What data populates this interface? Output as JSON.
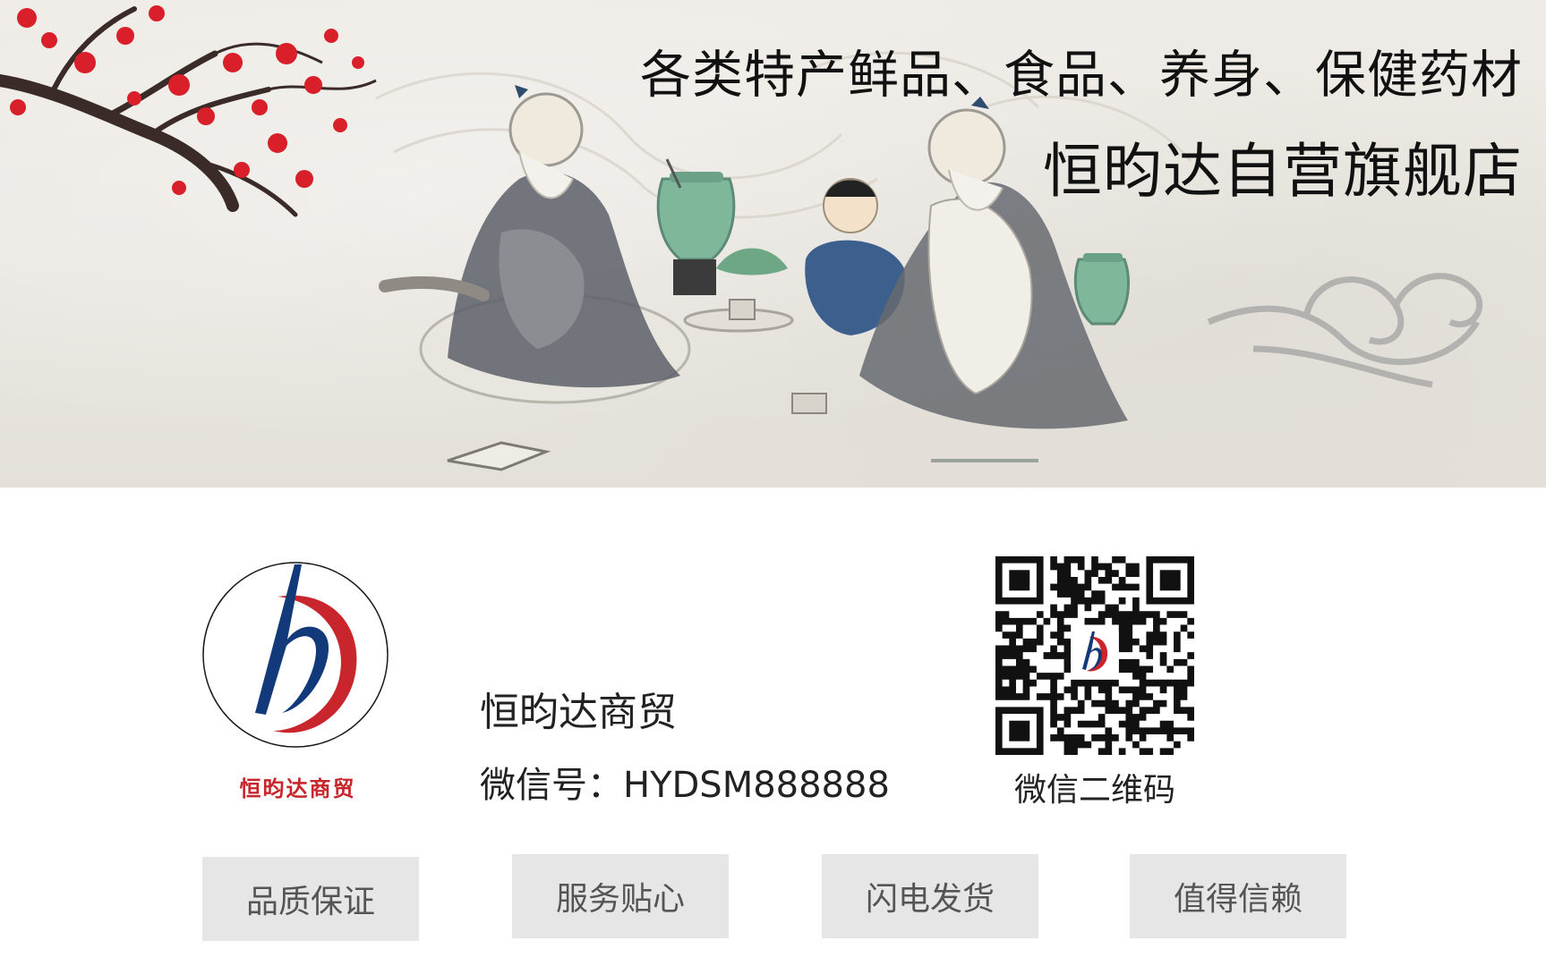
{
  "banner": {
    "headline": "各类特产鲜品、食品、养身、保健药材",
    "store_name": "恒昀达自营旗舰店"
  },
  "logo": {
    "caption": "恒昀达商贸",
    "colors": {
      "red": "#c8262c",
      "blue": "#123a7a"
    }
  },
  "company": {
    "name": "恒昀达商贸",
    "wechat_id": "微信号：HYDSM888888"
  },
  "qr": {
    "caption": "微信二维码"
  },
  "features": [
    {
      "label": "品质保证"
    },
    {
      "label": "服务贴心"
    },
    {
      "label": "闪电发货"
    },
    {
      "label": "值得信赖"
    }
  ]
}
